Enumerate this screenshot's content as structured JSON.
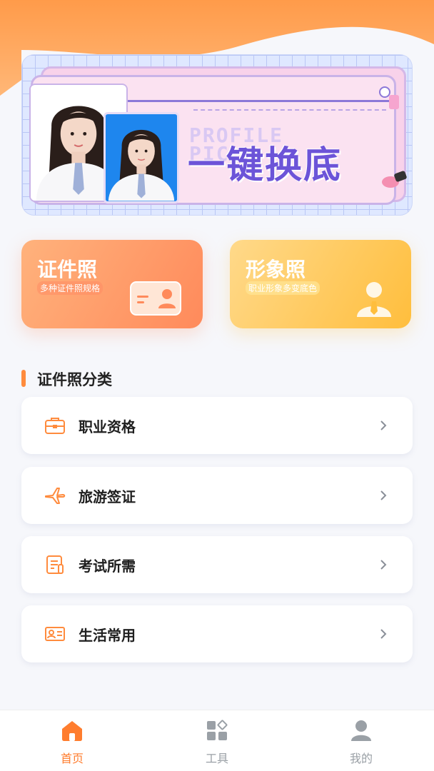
{
  "colors": {
    "accent": "#ff7d2e",
    "tab_inactive": "#9aa0a6",
    "section_bar": "#ff8b3d"
  },
  "banner": {
    "ghost_line1": "PROFILE",
    "ghost_line2": "PIC",
    "title": "一键换底"
  },
  "cards": [
    {
      "title": "证件照",
      "subtitle": "多种证件照规格",
      "icon": "id-card-icon"
    },
    {
      "title": "形象照",
      "subtitle": "职业形象多变底色",
      "icon": "person-tie-icon"
    }
  ],
  "section": {
    "title": "证件照分类"
  },
  "categories": [
    {
      "label": "职业资格",
      "icon": "briefcase-icon"
    },
    {
      "label": "旅游签证",
      "icon": "airplane-icon"
    },
    {
      "label": "考试所需",
      "icon": "exam-paper-icon"
    },
    {
      "label": "生活常用",
      "icon": "id-badge-icon"
    }
  ],
  "tabs": [
    {
      "label": "首页",
      "icon": "home-icon",
      "active": true
    },
    {
      "label": "工具",
      "icon": "tools-grid-icon",
      "active": false
    },
    {
      "label": "我的",
      "icon": "user-icon",
      "active": false
    }
  ]
}
